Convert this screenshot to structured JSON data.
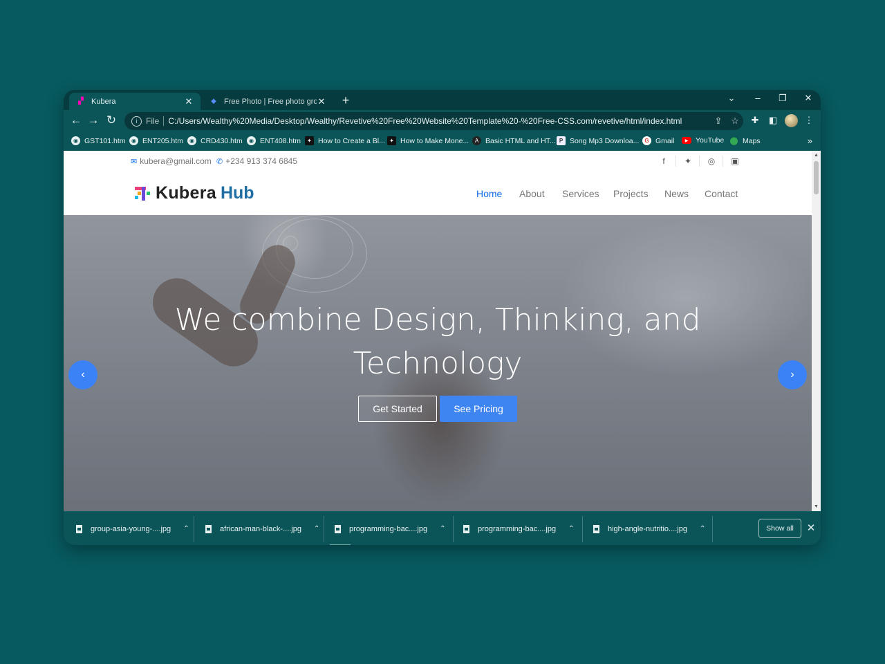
{
  "browser": {
    "tabs": [
      {
        "title": "Kubera",
        "active": true
      },
      {
        "title": "Free Photo | Free photo group of",
        "active": false
      }
    ],
    "new_tab": "+",
    "window_controls": [
      "chevron-down-icon",
      "minimize-icon",
      "restore-icon",
      "close-icon"
    ],
    "address": {
      "scheme": "File",
      "url": "C:/Users/Wealthy%20Media/Desktop/Wealthy/Revetive%20Free%20Website%20Template%20-%20Free-CSS.com/revetive/html/index.html"
    },
    "bookmarks": [
      {
        "label": "GST101.htm",
        "icon": "globe"
      },
      {
        "label": "ENT205.htm",
        "icon": "globe"
      },
      {
        "label": "CRD430.htm",
        "icon": "globe"
      },
      {
        "label": "ENT408.htm",
        "icon": "globe"
      },
      {
        "label": "How to Create a Bl...",
        "icon": "dark"
      },
      {
        "label": "How to Make Mone...",
        "icon": "dark"
      },
      {
        "label": "Basic HTML and HT...",
        "icon": "angular"
      },
      {
        "label": "Song Mp3 Downloa...",
        "icon": "song"
      },
      {
        "label": "Gmail",
        "icon": "gmail"
      },
      {
        "label": "YouTube",
        "icon": "youtube"
      },
      {
        "label": "Maps",
        "icon": "maps"
      }
    ],
    "bookmarks_more": "»"
  },
  "site": {
    "topbar": {
      "email": "kubera@gmail.com",
      "phone": "+234 913 374 6845"
    },
    "social": [
      "facebook-icon",
      "twitter-icon",
      "instagram-icon",
      "linkedin-icon"
    ],
    "logo": {
      "word1": "Kubera",
      "word2": "Hub"
    },
    "nav": [
      "Home",
      "About",
      "Services",
      "Projects",
      "News",
      "Contact"
    ],
    "nav_active": "Home",
    "hero": {
      "headline_line1": "We combine Design, Thinking, and",
      "headline_line2": "Technology",
      "btn_primary": "Get Started",
      "btn_secondary": "See Pricing",
      "prev": "‹",
      "next": "›"
    }
  },
  "downloads": {
    "items": [
      "group-asia-young-....jpg",
      "african-man-black-....jpg",
      "programming-bac....jpg",
      "programming-bac....jpg",
      "high-angle-nutritio....jpg"
    ],
    "show_all": "Show all",
    "close": "✕"
  },
  "colors": {
    "accent": "#106eea",
    "button_blue": "#3f85f2",
    "browser_frame": "#0b5559",
    "desktop": "#075a5f"
  }
}
